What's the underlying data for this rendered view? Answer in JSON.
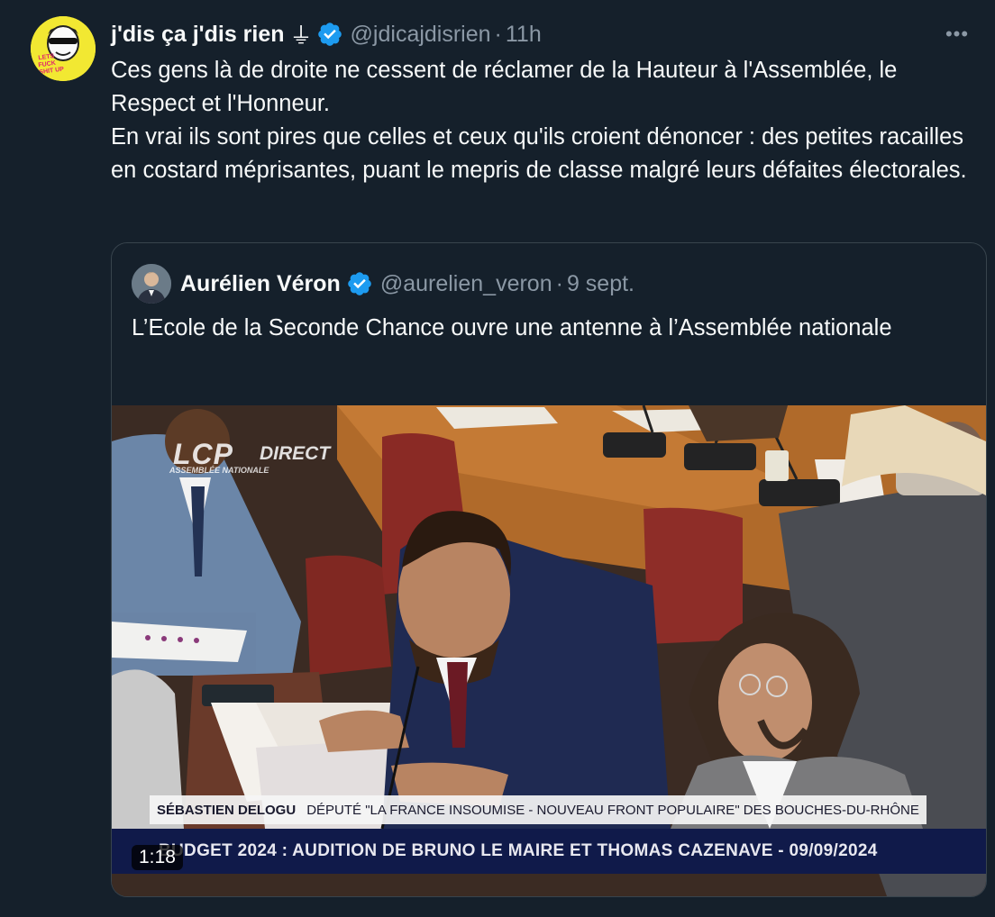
{
  "tweet": {
    "author_name": "j'dis ça j'dis rien",
    "name_glyph": "⏚",
    "handle": "@jdicajdisrien",
    "separator": "·",
    "time": "11h",
    "more_label": "•••",
    "text_lines": [
      "Ces gens là de droite ne cessent de réclamer de la Hauteur à l'Assemblée, le Respect et l'Honneur.",
      "En vrai ils sont pires que celles et ceux qu'ils croient dénoncer : des petites racailles en costard méprisantes, puant le mepris de classe malgré leurs défaites électorales."
    ],
    "avatar_text": "LETS FUCK SHIT UP"
  },
  "quote": {
    "author_name": "Aurélien Véron",
    "handle": "@aurelien_veron",
    "separator": "·",
    "date": "9 sept.",
    "text": "L’Ecole de la Seconde Chance ouvre une antenne à l’Assemblée nationale",
    "media": {
      "channel_logo": "LCP",
      "channel_sub": "ASSEMBLÉE NATIONALE",
      "live_label": "DIRECT",
      "speaker_name": "SÉBASTIEN DELOGU",
      "speaker_role": "DÉPUTÉ \"LA FRANCE INSOUMISE - NOUVEAU FRONT POPULAIRE\" DES BOUCHES-DU-RHÔNE",
      "banner": "BUDGET 2024 : AUDITION DE BRUNO LE MAIRE ET THOMAS CAZENAVE  - 09/09/2024",
      "duration": "1:18"
    }
  },
  "colors": {
    "background": "#15202b",
    "text_primary": "#f7f9f9",
    "text_secondary": "#8b98a5",
    "verified": "#1d9bf0",
    "border": "#38444d"
  }
}
